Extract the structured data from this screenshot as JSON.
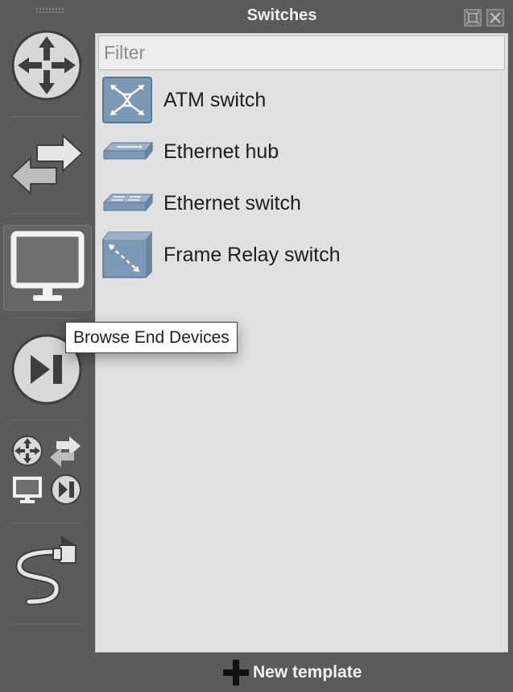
{
  "dock": {
    "title": "Switches"
  },
  "filter": {
    "placeholder": "Filter",
    "value": ""
  },
  "devices": [
    {
      "label": "ATM switch",
      "icon": "atm-switch-icon"
    },
    {
      "label": "Ethernet hub",
      "icon": "ethernet-hub-icon"
    },
    {
      "label": "Ethernet switch",
      "icon": "ethernet-switch-icon"
    },
    {
      "label": "Frame Relay switch",
      "icon": "frame-relay-switch-icon"
    }
  ],
  "sidebar": {
    "buttons": [
      {
        "name": "routers",
        "icon": "router-icon"
      },
      {
        "name": "switches",
        "icon": "switch-arrows-icon"
      },
      {
        "name": "end-devices",
        "icon": "monitor-icon",
        "active": true
      },
      {
        "name": "security-devices",
        "icon": "play-pause-icon"
      },
      {
        "name": "all-devices",
        "icon": "all-devices-icon"
      },
      {
        "name": "add-link",
        "icon": "cable-icon"
      }
    ]
  },
  "tooltip": {
    "text": "Browse End Devices"
  },
  "footer": {
    "new_template_label": "New template"
  },
  "colors": {
    "background": "#5b5b5b",
    "panel": "#e1e1e1",
    "device_blue": "#7b98b5"
  }
}
